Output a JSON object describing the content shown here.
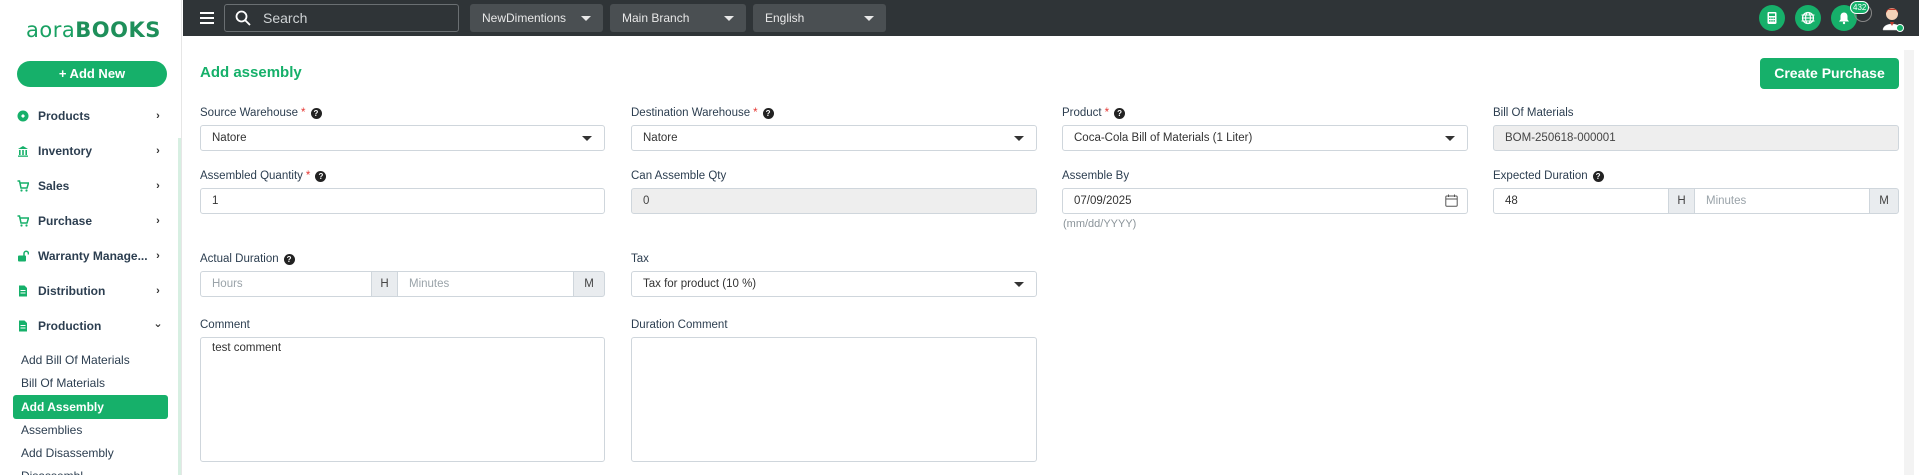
{
  "brand": {
    "logo_light": "aora",
    "logo_bold": "BOOKS"
  },
  "sidebar": {
    "add_new_label": "+ Add New",
    "items": [
      {
        "label": "Products",
        "icon": "products-icon",
        "chevron": "›"
      },
      {
        "label": "Inventory",
        "icon": "inventory-icon",
        "chevron": "›"
      },
      {
        "label": "Sales",
        "icon": "cart-icon",
        "chevron": "›"
      },
      {
        "label": "Purchase",
        "icon": "cart-icon",
        "chevron": "›"
      },
      {
        "label": "Warranty Manage...",
        "icon": "unlock-icon",
        "chevron": "›"
      },
      {
        "label": "Distribution",
        "icon": "document-icon",
        "chevron": "›"
      },
      {
        "label": "Production",
        "icon": "document-icon",
        "chevron": "⌄"
      }
    ],
    "sub_items": [
      {
        "label": "Add Bill Of Materials"
      },
      {
        "label": "Bill Of Materials"
      },
      {
        "label": "Add Assembly"
      },
      {
        "label": "Assemblies"
      },
      {
        "label": "Add Disassembly"
      },
      {
        "label": "Disassembl..."
      }
    ]
  },
  "topbar": {
    "search_placeholder": "Search",
    "company": "NewDimentions",
    "branch": "Main Branch",
    "language": "English",
    "notification_count": "432",
    "accent": "#16b06a"
  },
  "page": {
    "title": "Add assembly",
    "create_purchase_label": "Create Purchase"
  },
  "form": {
    "source_warehouse": {
      "label": "Source Warehouse",
      "value": "Natore"
    },
    "destination_warehouse": {
      "label": "Destination Warehouse",
      "value": "Natore"
    },
    "product": {
      "label": "Product",
      "value": "Coca-Cola Bill of Materials (1 Liter)"
    },
    "bill_of_materials": {
      "label": "Bill Of Materials",
      "value": "BOM-250618-000001"
    },
    "assembled_quantity": {
      "label": "Assembled Quantity",
      "value": "1"
    },
    "can_assemble_qty": {
      "label": "Can Assemble Qty",
      "value": "0"
    },
    "assemble_by": {
      "label": "Assemble By",
      "value": "07/09/2025",
      "hint": "(mm/dd/YYYY)"
    },
    "expected_duration": {
      "label": "Expected Duration",
      "hours": "48",
      "hours_addon": "H",
      "minutes_placeholder": "Minutes",
      "minutes_addon": "M"
    },
    "actual_duration": {
      "label": "Actual Duration",
      "hours_placeholder": "Hours",
      "hours_addon": "H",
      "minutes_placeholder": "Minutes",
      "minutes_addon": "M"
    },
    "tax": {
      "label": "Tax",
      "value": "Tax for product (10 %)"
    },
    "comment": {
      "label": "Comment",
      "value": "test comment"
    },
    "duration_comment": {
      "label": "Duration Comment",
      "value": ""
    },
    "required_mark": "*",
    "help_mark": "?"
  }
}
